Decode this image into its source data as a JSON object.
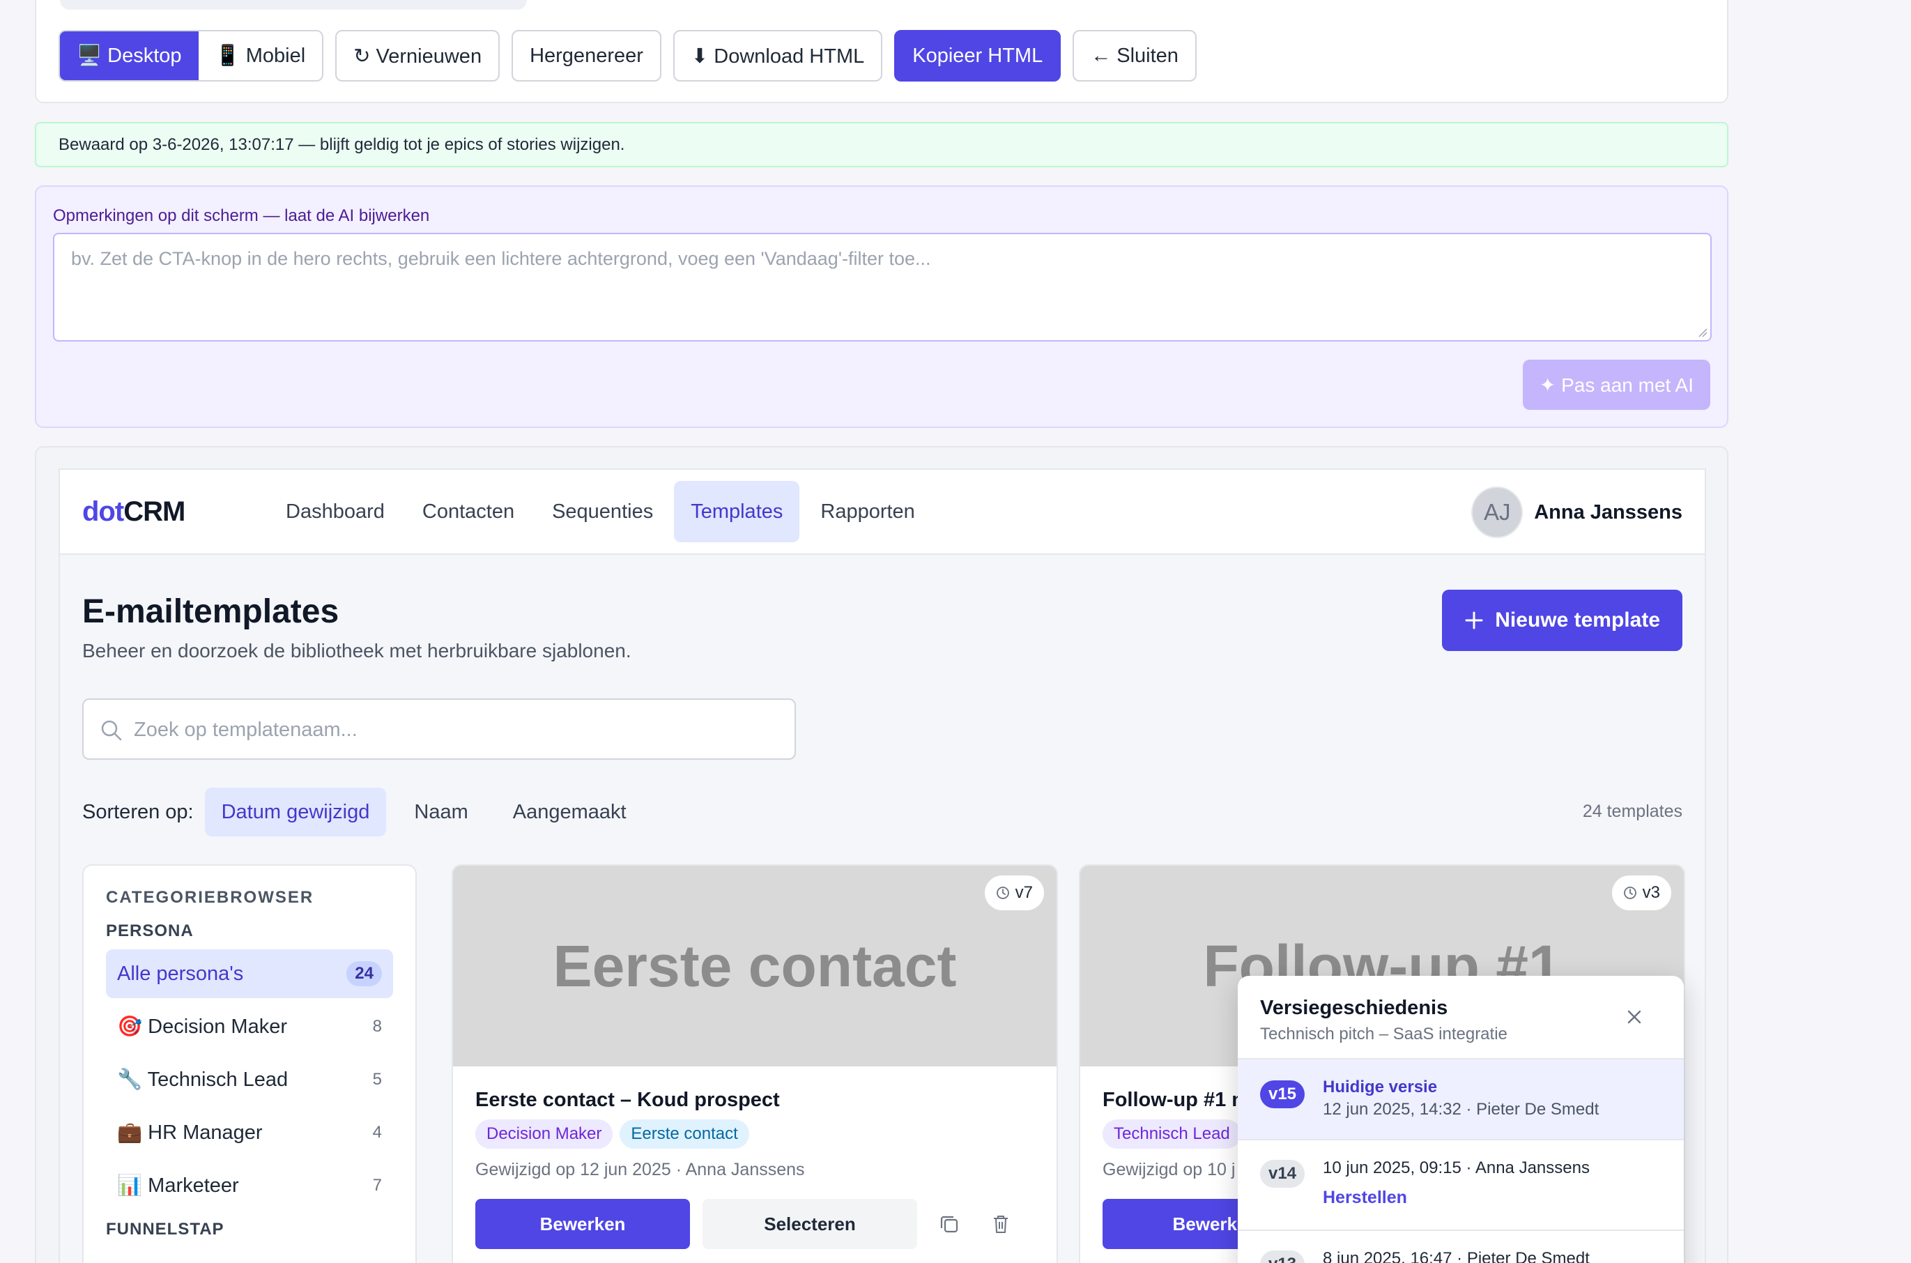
{
  "toolbar": {
    "desktop_label": "🖥️ Desktop",
    "mobile_label": "📱 Mobiel",
    "refresh_label": "↻ Vernieuwen",
    "regenerate_label": "Hergenereer",
    "download_label": "⬇ Download HTML",
    "copy_label": "Kopieer HTML",
    "close_label": "← Sluiten"
  },
  "saved_notice": "Bewaard op 3-6-2026, 13:07:17 — blijft geldig tot je epics of stories wijzigen.",
  "ai_panel": {
    "label": "Opmerkingen op dit scherm — laat de AI bijwerken",
    "placeholder": "bv. Zet de CTA-knop in de hero rechts, gebruik een lichtere achtergrond, voeg een 'Vandaag'-filter toe...",
    "button_label": "✦ Pas aan met AI"
  },
  "app": {
    "logo_a": "dot",
    "logo_b": "CRM",
    "nav": [
      "Dashboard",
      "Contacten",
      "Sequenties",
      "Templates",
      "Rapporten"
    ],
    "active_nav": "Templates",
    "user_initials": "AJ",
    "user_name": "Anna Janssens",
    "page_title": "E-mailtemplates",
    "page_subtitle": "Beheer en doorzoek de bibliotheek met herbruikbare sjablonen.",
    "new_button": "Nieuwe template",
    "search_placeholder": "Zoek op templatenaam...",
    "sort_label": "Sorteren op:",
    "sort_options": [
      "Datum gewijzigd",
      "Naam",
      "Aangemaakt"
    ],
    "template_count": "24 templates"
  },
  "categories": {
    "heading": "CATEGORIEBROWSER",
    "group_persona": "PERSONA",
    "items": [
      {
        "label": "Alle persona's",
        "count": "24"
      },
      {
        "label": "🎯 Decision Maker",
        "count": "8"
      },
      {
        "label": "🔧 Technisch Lead",
        "count": "5"
      },
      {
        "label": "💼 HR Manager",
        "count": "4"
      },
      {
        "label": "📊 Marketeer",
        "count": "7"
      }
    ],
    "group_funnel": "FUNNELSTAP"
  },
  "cards": [
    {
      "thumb_text": "Eerste contact",
      "version": "v7",
      "title": "Eerste contact – Koud prospect",
      "tags": [
        "Decision Maker",
        "Eerste contact"
      ],
      "meta": "Gewijzigd op 12 jun 2025 · Anna Janssens",
      "edit_label": "Bewerken",
      "select_label": "Selecteren"
    },
    {
      "thumb_text": "Follow-up #1",
      "version": "v3",
      "title": "Follow-up #1 n",
      "tags": [
        "Technisch Lead"
      ],
      "meta": "Gewijzigd op 10 j",
      "edit_label": "Bewerke"
    }
  ],
  "history": {
    "title": "Versiegeschiedenis",
    "subtitle": "Technisch pitch – SaaS integratie",
    "entries": [
      {
        "badge": "v15",
        "title": "Huidige versie",
        "meta": "12 jun 2025, 14:32 · Pieter De Smedt"
      },
      {
        "badge": "v14",
        "meta": "10 jun 2025, 09:15 · Anna Janssens",
        "action": "Herstellen"
      },
      {
        "badge": "v13",
        "meta": "8 jun 2025, 16:47 · Pieter De Smedt"
      }
    ]
  },
  "colors": {
    "accent": "#4f46e5",
    "accent_light": "#e0e7ff",
    "success_bg": "#ecfdf3",
    "ai_panel_bg": "#f3f0ff"
  }
}
